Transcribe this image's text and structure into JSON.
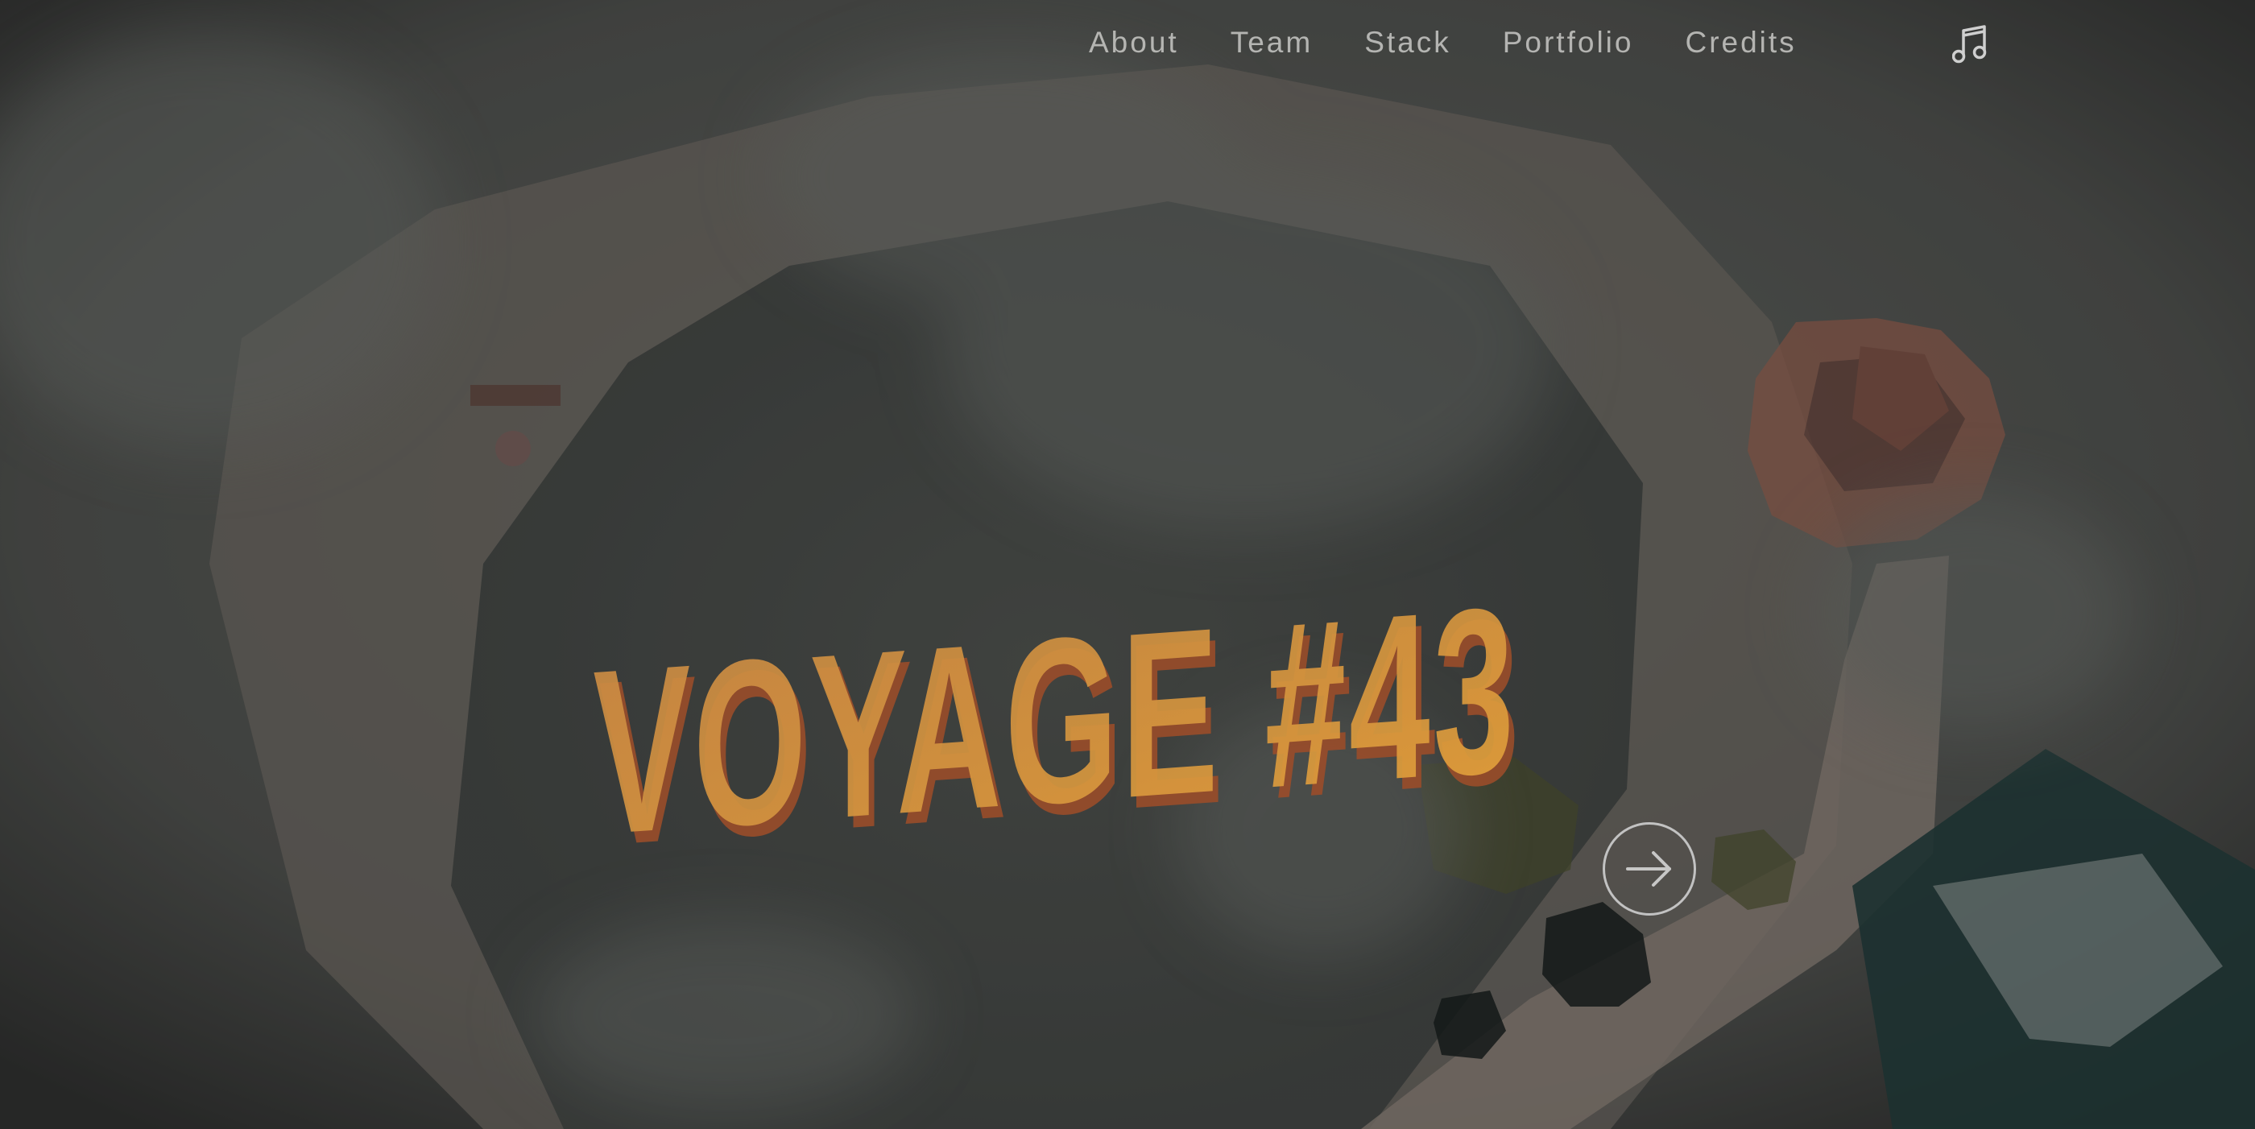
{
  "nav": {
    "items": [
      {
        "label": "About"
      },
      {
        "label": "Team"
      },
      {
        "label": "Stack"
      },
      {
        "label": "Portfolio"
      },
      {
        "label": "Credits"
      }
    ],
    "music_icon": "music-note-icon"
  },
  "hero": {
    "title": "VOYAGE #43",
    "next_icon": "arrow-right-icon"
  },
  "colors": {
    "title_face": "#d99a44",
    "title_side": "#a8552c",
    "fog": "#5c5e5a",
    "path": "#8a7f74",
    "teal_crystal": "#1f3c3c",
    "nav_text": "#c9c9c6"
  }
}
